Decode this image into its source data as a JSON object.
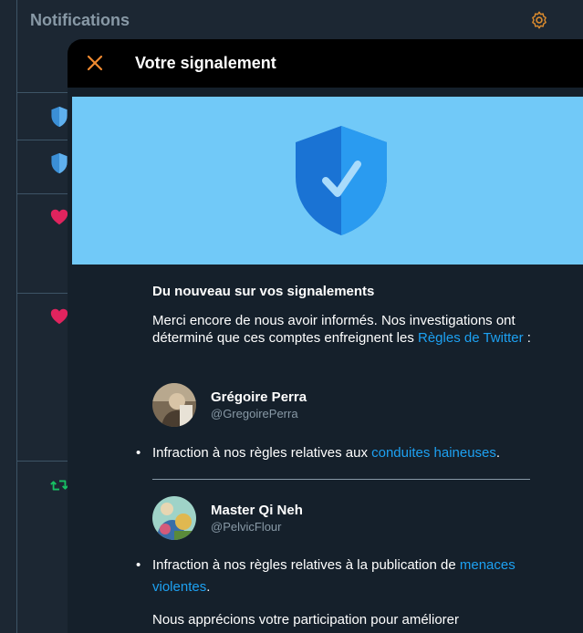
{
  "background": {
    "title": "Notifications",
    "gear_icon": "gear-icon"
  },
  "modal": {
    "title": "Votre signalement",
    "close_icon": "close-icon",
    "banner_icon": "shield-check-icon",
    "heading": "Du nouveau sur vos signalements",
    "intro_text": "Merci encore de nous avoir informés. Nos investigations ont déterminé que ces comptes enfreignent les ",
    "intro_link": "Règles de Twitter",
    "intro_end": " :",
    "accounts": [
      {
        "name": "Grégoire Perra",
        "handle": "@GregoirePerra",
        "violation_text": "Infraction à nos règles relatives aux ",
        "violation_link": "conduites haineuses",
        "violation_end": "."
      },
      {
        "name": "Master Qi Neh",
        "handle": "@PelvicFlour",
        "violation_text": "Infraction à nos règles relatives à la publication de ",
        "violation_link": "menaces violentes",
        "violation_end": "."
      }
    ],
    "closing": "Nous apprécions votre participation pour améliorer"
  },
  "colors": {
    "accent": "#1da1f2",
    "close": "#f08a30",
    "banner": "#71c9f8"
  }
}
